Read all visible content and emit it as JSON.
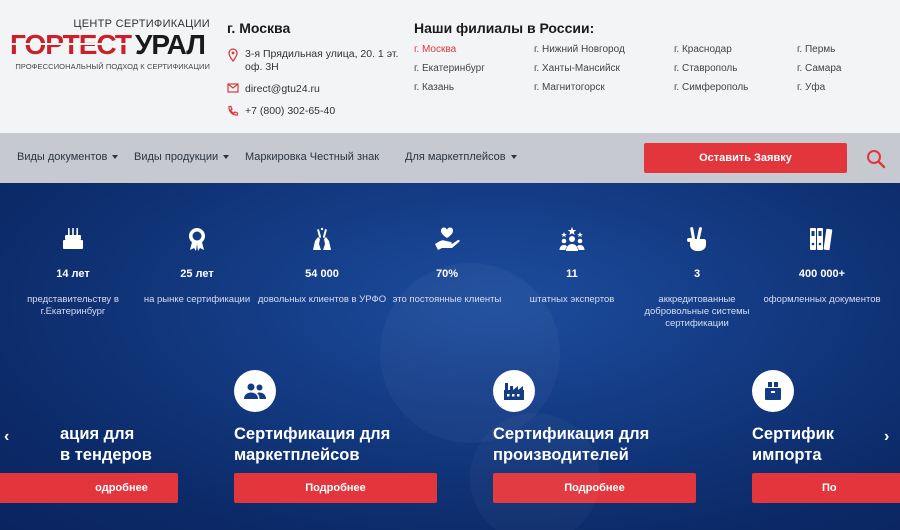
{
  "logo": {
    "small_title": "ЦЕНТР СЕРТИФИКАЦИИ",
    "brand_part1": "ГОРТЕСТ",
    "brand_part2": "УРАЛ",
    "tagline": "ПРОФЕССИОНАЛЬНЫЙ ПОДХОД К СЕРТИФИКАЦИИ"
  },
  "contacts": {
    "city": "г. Москва",
    "address": "3-я Прядильная улица, 20. 1 эт. оф. 3Н",
    "email": "direct@gtu24.ru",
    "phone": "+7 (800) 302-65-40"
  },
  "branches": {
    "title": "Наши филиалы в России:",
    "items": [
      "г. Москва",
      "г. Нижний Новгород",
      "г. Краснодар",
      "г. Пермь",
      "г. Екатеринбург",
      "г. Ханты-Мансийск",
      "г. Ставрополь",
      "г. Самара",
      "г. Казань",
      "г. Магнитогорск",
      "г. Симферополь",
      "г. Уфа"
    ],
    "active": "г. Москва"
  },
  "nav": {
    "items": [
      "Виды документов",
      "Виды продукции",
      "Маркировка Честный знак",
      "Для маркетплейсов"
    ],
    "cta": "Оставить Заявку"
  },
  "stats": [
    {
      "icon": "cake-icon",
      "value": "14 лет",
      "desc": "представительству в г.Екатеринбург"
    },
    {
      "icon": "award-icon",
      "value": "25 лет",
      "desc": "на рынке сертификации"
    },
    {
      "icon": "high-five-icon",
      "value": "54 000",
      "desc": "довольных клиентов в УРФО"
    },
    {
      "icon": "hand-heart-icon",
      "value": "70%",
      "desc": "это постоянные клиенты"
    },
    {
      "icon": "team-icon",
      "value": "11",
      "desc": "штатных экспертов"
    },
    {
      "icon": "victory-hand-icon",
      "value": "3",
      "desc": "аккредитованные добровольные системы сертификации"
    },
    {
      "icon": "binders-icon",
      "value": "400 000+",
      "desc": "оформленных документов"
    }
  ],
  "cards": [
    {
      "icon": "",
      "title": "ация для\nв тендеров",
      "button": "одробнее"
    },
    {
      "icon": "users-icon",
      "title": "Сертификация для\nмаркетплейсов",
      "button": "Подробнее"
    },
    {
      "icon": "factory-icon",
      "title": "Сертификация для\nпроизводителей",
      "button": "Подробнее"
    },
    {
      "icon": "import-box-icon",
      "title": "Сертифик\nимпорта",
      "button": "По"
    }
  ],
  "carousel": {
    "prev": "‹",
    "next": "›"
  },
  "colors": {
    "accent": "#e2363c",
    "hero_bg": "#143c85",
    "header_bg": "#f2f4f6",
    "nav_bg": "#c6cad0"
  }
}
